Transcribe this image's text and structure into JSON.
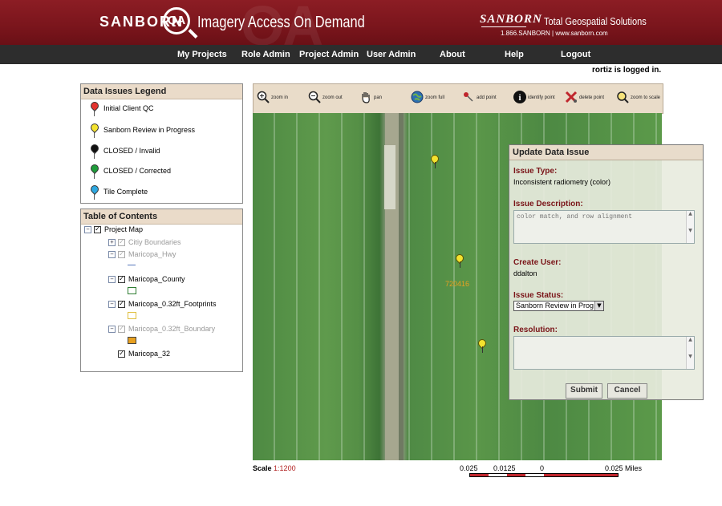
{
  "header": {
    "brand": "SANBORN",
    "logo": "QA",
    "tagline": "Imagery Access On Demand",
    "right_brand": "SANBORN",
    "right_tagline": "Total Geospatial Solutions",
    "right_contact": "1.866.SANBORN | www.sanborn.com"
  },
  "nav": {
    "items": [
      {
        "label": "My Projects"
      },
      {
        "label": "Role Admin"
      },
      {
        "label": "Project Admin"
      },
      {
        "label": "User Admin"
      },
      {
        "label": "About"
      },
      {
        "label": "Help"
      },
      {
        "label": "Logout"
      }
    ]
  },
  "user_status": "rortiz is logged in.",
  "legend": {
    "title": "Data Issues Legend",
    "items": [
      {
        "label": "Initial Client QC",
        "color": "#e3342f"
      },
      {
        "label": "Sanborn Review in Progress",
        "color": "#f3e22f"
      },
      {
        "label": "CLOSED / Invalid",
        "color": "#111111"
      },
      {
        "label": "CLOSED / Corrected",
        "color": "#1e9c3a"
      },
      {
        "label": "Tile Complete",
        "color": "#2ea8e0"
      }
    ]
  },
  "toc": {
    "title": "Table of Contents",
    "items": [
      {
        "label": "Project Map",
        "checked": true
      },
      {
        "label": "Citiy Boundaries",
        "checked": true,
        "disabled": true
      },
      {
        "label": "Maricopa_Hwy",
        "checked": true,
        "disabled": true
      },
      {
        "label": "Maricopa_County",
        "checked": true
      },
      {
        "label": "Maricopa_0.32ft_Footprints",
        "checked": true
      },
      {
        "label": "Maricopa_0.32ft_Boundary",
        "checked": true,
        "disabled": true
      },
      {
        "label": "Maricopa_32",
        "checked": true
      }
    ],
    "symbols": {
      "hwy": "#5577bb",
      "county": "#2e7d32",
      "footprints": "#e0c040",
      "boundary": "#e8a020"
    }
  },
  "toolbar": {
    "tools": [
      {
        "label": "zoom in",
        "icon": "zoom-in-icon"
      },
      {
        "label": "zoom out",
        "icon": "zoom-out-icon"
      },
      {
        "label": "pan",
        "icon": "pan-hand-icon"
      },
      {
        "label": "zoom full",
        "icon": "globe-icon"
      },
      {
        "label": "add point",
        "icon": "add-point-icon"
      },
      {
        "label": "identify point",
        "icon": "info-icon"
      },
      {
        "label": "delete point",
        "icon": "delete-point-icon"
      },
      {
        "label": "zoom to scale",
        "icon": "zoom-scale-icon"
      }
    ]
  },
  "map": {
    "tile_label": "720416"
  },
  "issue_dialog": {
    "title": "Update Data Issue",
    "issue_type_label": "Issue Type:",
    "issue_type_value": "Inconsistent radiometry (color)",
    "description_label": "Issue Description:",
    "description_value": "color match, and row alignment",
    "create_user_label": "Create User:",
    "create_user_value": "ddalton",
    "status_label": "Issue Status:",
    "status_value": "Sanborn Review in Prog",
    "resolution_label": "Resolution:",
    "resolution_value": "",
    "submit": "Submit",
    "cancel": "Cancel"
  },
  "scale": {
    "label": "Scale",
    "value": "1:1200",
    "bar_labels": [
      "0.025",
      "0.0125",
      "0",
      "0.025 Miles"
    ]
  }
}
